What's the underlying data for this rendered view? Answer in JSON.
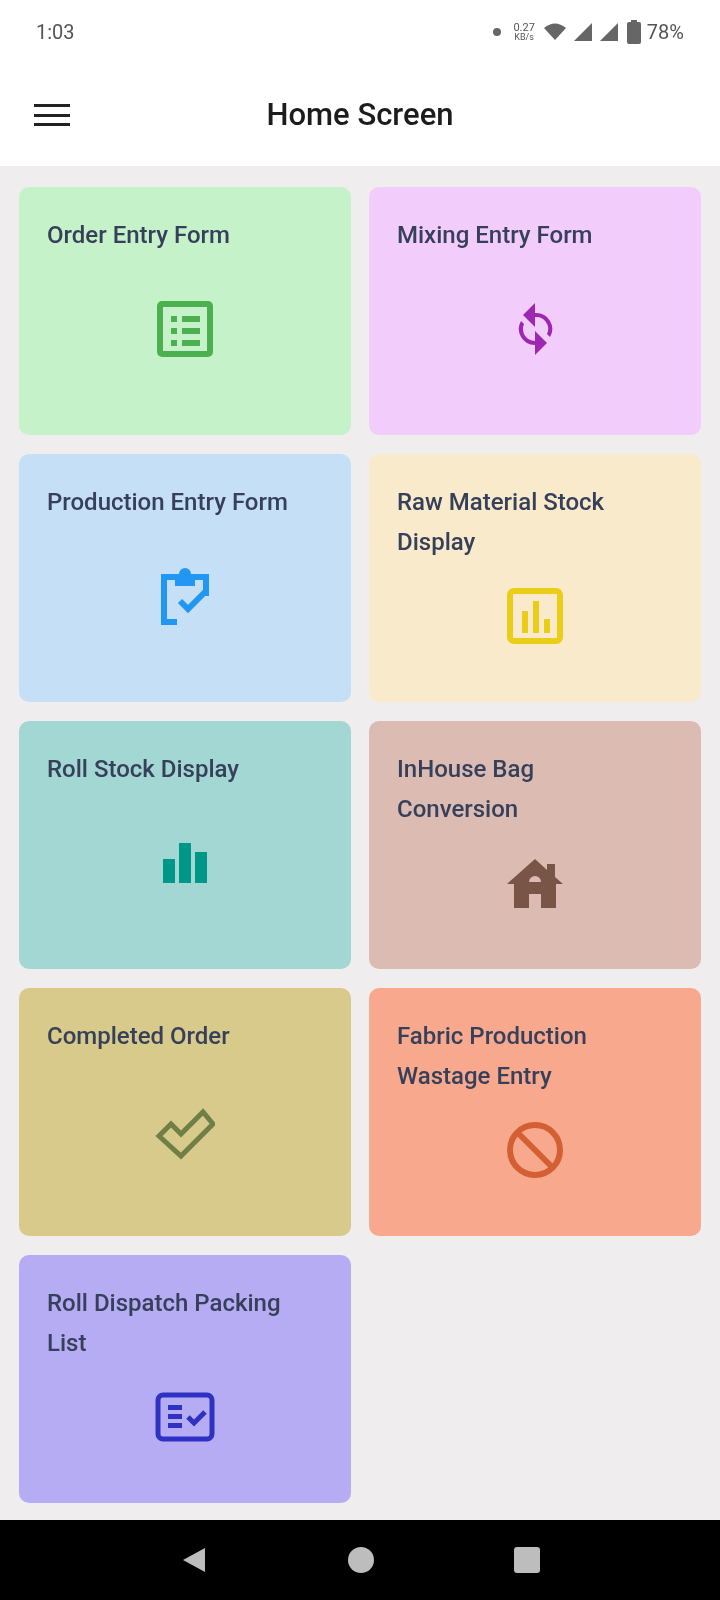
{
  "status_bar": {
    "time": "1:03",
    "net_speed": "0.27",
    "net_unit": "KB/s",
    "battery": "78%"
  },
  "app_bar": {
    "title": "Home Screen"
  },
  "tiles": [
    {
      "title": "Order Entry Form",
      "color": "#c6f2ca",
      "kind": "list"
    },
    {
      "title": "Mixing Entry Form",
      "color": "#f2ccfa",
      "kind": "sync"
    },
    {
      "title": "Production Entry Form",
      "color": "#c4dff6",
      "kind": "clipboard"
    },
    {
      "title": "Raw Material Stock Display",
      "color": "#f8eacb",
      "kind": "report"
    },
    {
      "title": "Roll Stock Display",
      "color": "#a2d7d3",
      "kind": "bars"
    },
    {
      "title": "InHouse Bag Conversion",
      "color": "#dcbcb2",
      "kind": "house"
    },
    {
      "title": "Completed Order",
      "color": "#d7ca8b",
      "kind": "check"
    },
    {
      "title": "Fabric Production Wastage Entry",
      "color": "#f8a98d",
      "kind": "block"
    },
    {
      "title": "Roll Dispatch Packing List",
      "color": "#b6acf3",
      "kind": "checklist"
    }
  ]
}
